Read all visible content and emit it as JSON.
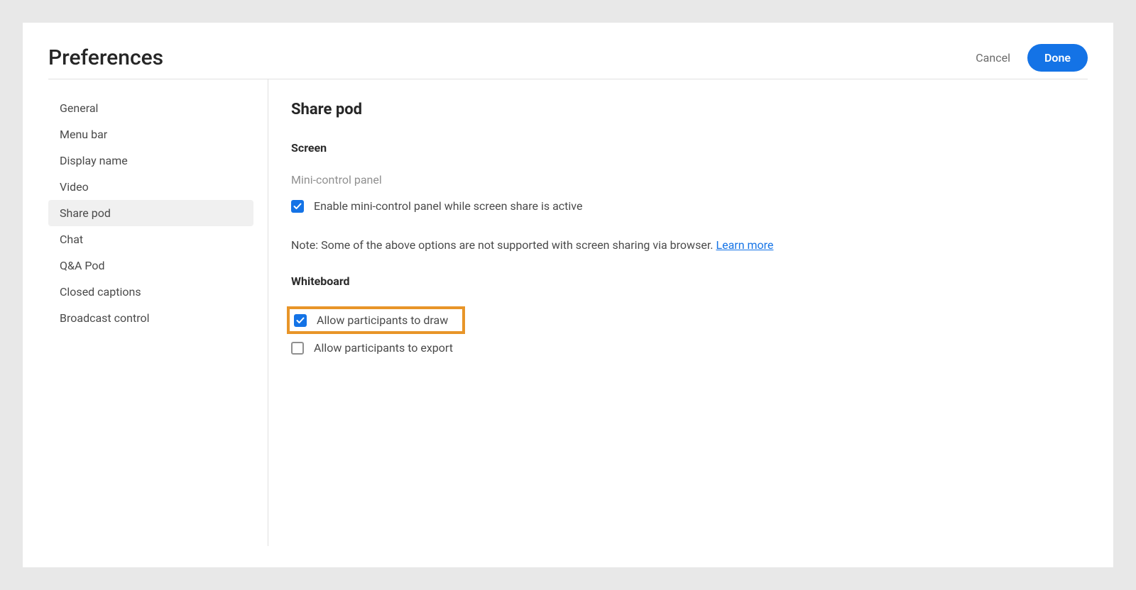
{
  "header": {
    "title": "Preferences",
    "cancel_label": "Cancel",
    "done_label": "Done"
  },
  "sidebar": {
    "items": [
      {
        "label": "General",
        "active": false
      },
      {
        "label": "Menu bar",
        "active": false
      },
      {
        "label": "Display name",
        "active": false
      },
      {
        "label": "Video",
        "active": false
      },
      {
        "label": "Share pod",
        "active": true
      },
      {
        "label": "Chat",
        "active": false
      },
      {
        "label": "Q&A Pod",
        "active": false
      },
      {
        "label": "Closed captions",
        "active": false
      },
      {
        "label": "Broadcast control",
        "active": false
      }
    ]
  },
  "main": {
    "panel_title": "Share pod",
    "screen_section": {
      "title": "Screen",
      "subsection": "Mini-control panel",
      "enable_mini_control": {
        "label": "Enable mini-control panel while screen share is active",
        "checked": true
      },
      "note_prefix": "Note: Some of the above options are not supported with screen sharing via browser. ",
      "learn_more": "Learn more"
    },
    "whiteboard_section": {
      "title": "Whiteboard",
      "allow_draw": {
        "label": "Allow participants to draw",
        "checked": true,
        "highlighted": true
      },
      "allow_export": {
        "label": "Allow participants to export",
        "checked": false
      }
    }
  }
}
